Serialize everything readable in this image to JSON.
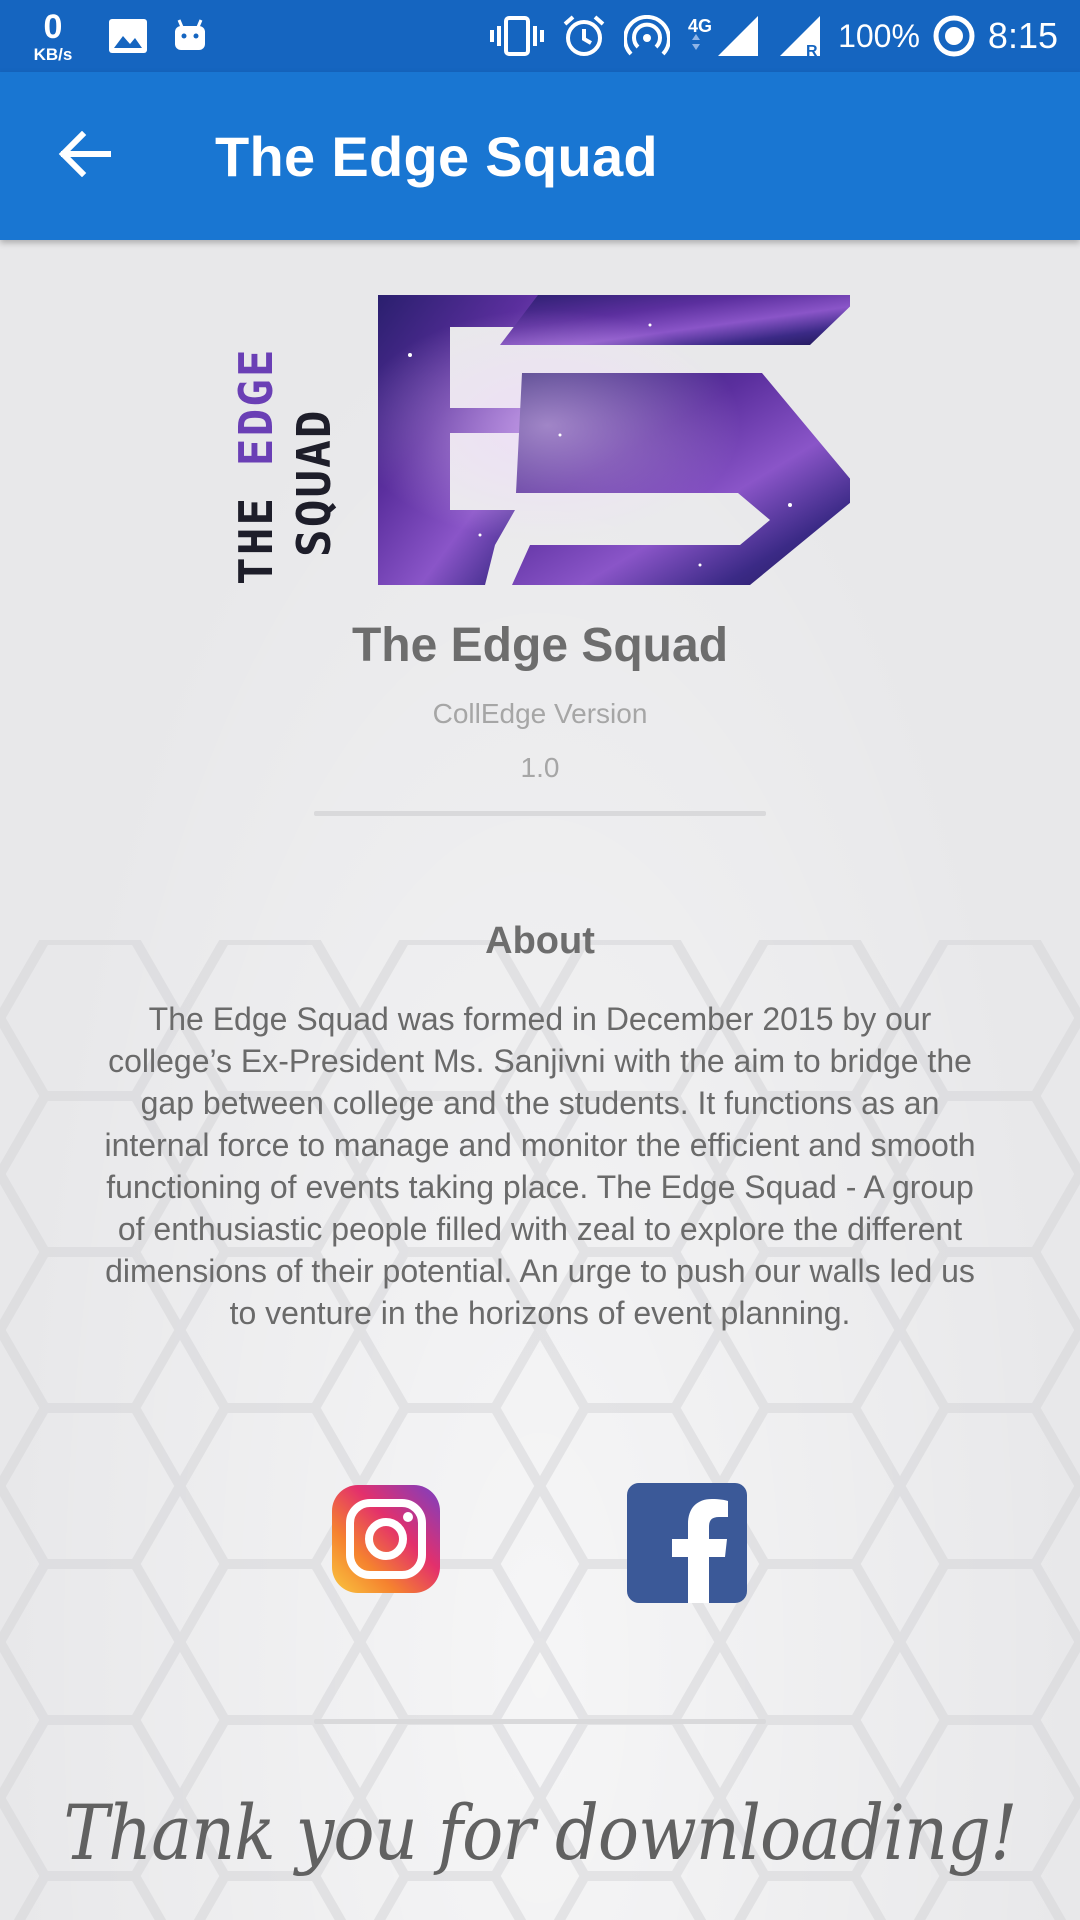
{
  "status_bar": {
    "speed_value": "0",
    "speed_unit": "KB/s",
    "battery": "100%",
    "network": "4G",
    "time": "8:15",
    "icons": [
      "image-icon",
      "android-icon",
      "vibrate-icon",
      "alarm-icon",
      "hotspot-icon",
      "signal-icon",
      "roaming-signal-icon",
      "battery-ring-icon"
    ]
  },
  "app_bar": {
    "back_icon": "arrow-left-icon",
    "title": "The Edge Squad"
  },
  "logo": {
    "vertical_line1_a": "THE ",
    "vertical_line1_b": "EDGE",
    "vertical_line2": "SQUAD",
    "accent_color": "#6a3fb5"
  },
  "main": {
    "app_name": "The Edge Squad",
    "version_label": "CollEdge Version",
    "version_value": "1.0",
    "about_heading": "About",
    "about_text": "The Edge Squad was formed in December 2015 by our college’s Ex-President Ms. Sanjivni with the aim to bridge the gap between college and the students. It functions as an internal force to manage and monitor the efficient and smooth functioning of events taking place. The Edge Squad - A group of enthusiastic people filled with zeal to explore the different dimensions of their potential. An urge to push our walls led us to venture in the horizons of event planning.",
    "social": [
      {
        "name": "instagram",
        "icon": "instagram-icon"
      },
      {
        "name": "facebook",
        "icon": "facebook-icon"
      }
    ],
    "thanks": "Thank you for downloading!"
  },
  "colors": {
    "status_bar": "#1565c0",
    "app_bar": "#1976d2",
    "facebook": "#3b5998"
  }
}
